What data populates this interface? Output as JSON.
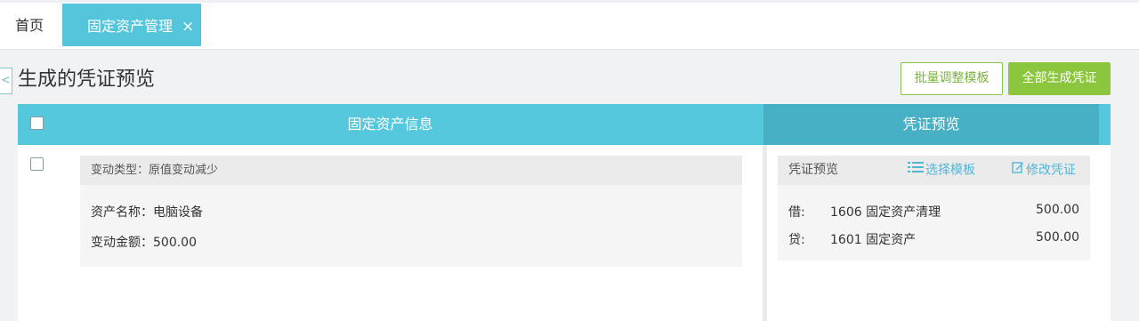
{
  "tabs": {
    "home_label": "首页",
    "active_label": "固定资产管理",
    "close_glyph": "×"
  },
  "header": {
    "back_glyph": "<",
    "title": "生成的凭证预览",
    "batch_button": "批量调整模板",
    "generate_all_button": "全部生成凭证"
  },
  "table": {
    "left_header": "固定资产信息",
    "right_header": "凭证预览"
  },
  "record": {
    "change_type": "变动类型：原值变动减少",
    "asset_name": "资产名称：电脑设备",
    "change_amount": "变动金额：500.00"
  },
  "voucher": {
    "title": "凭证预览",
    "select_template": "选择模板",
    "edit_voucher": "修改凭证",
    "entries": [
      {
        "direction": "借:",
        "account": "1606 固定资产清理",
        "amount": "500.00"
      },
      {
        "direction": "贷:",
        "account": "1601 固定资产",
        "amount": "500.00"
      }
    ]
  },
  "colors": {
    "tab_active": "#55c5dc",
    "header_bg": "#55c8de",
    "header_right_bg": "#47b0c4",
    "primary_green": "#8cc63f",
    "link_blue": "#4fb6d8"
  }
}
